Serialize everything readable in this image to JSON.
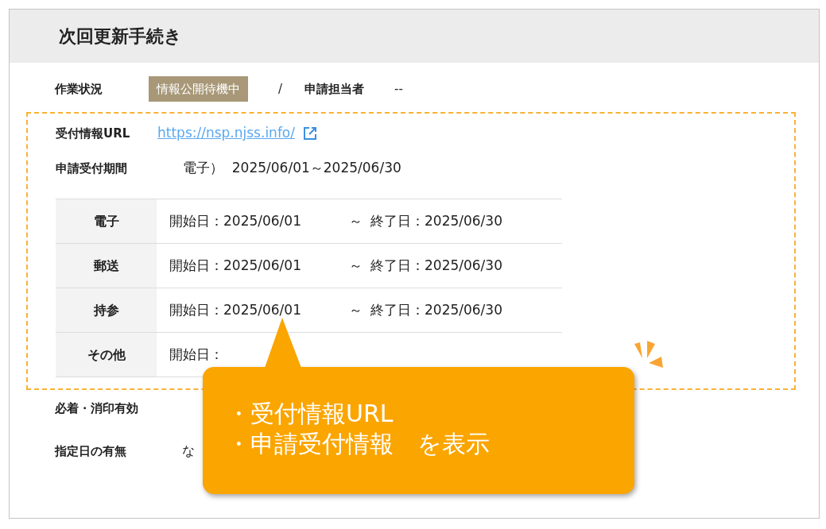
{
  "panel": {
    "title": "次回更新手続き"
  },
  "status_row": {
    "label": "作業状況",
    "status_badge": "情報公開待機中",
    "separator": "/",
    "assignee_label": "申請担当者",
    "assignee_value": "--"
  },
  "highlight_box": {
    "url_row": {
      "label": "受付情報URL",
      "link": "https://nsp.njss.info/"
    },
    "period_row": {
      "label": "申請受付期間",
      "value": "電子）  2025/06/01～2025/06/30"
    },
    "table": {
      "rows": [
        {
          "method": "電子",
          "start": "開始日：2025/06/01",
          "tilde": "～",
          "end": "終了日：2025/06/30"
        },
        {
          "method": "郵送",
          "start": "開始日：2025/06/01",
          "tilde": "～",
          "end": "終了日：2025/06/30"
        },
        {
          "method": "持参",
          "start": "開始日：2025/06/01",
          "tilde": "～",
          "end": "終了日：2025/06/30"
        },
        {
          "method": "その他",
          "start": "開始日："
        }
      ]
    }
  },
  "lower_rows": [
    {
      "label": "必着・消印有効"
    },
    {
      "label": "指定日の有無",
      "value": "な"
    }
  ],
  "callout": {
    "lines": [
      "・受付情報URL",
      "・申請受付情報　を表示"
    ]
  }
}
